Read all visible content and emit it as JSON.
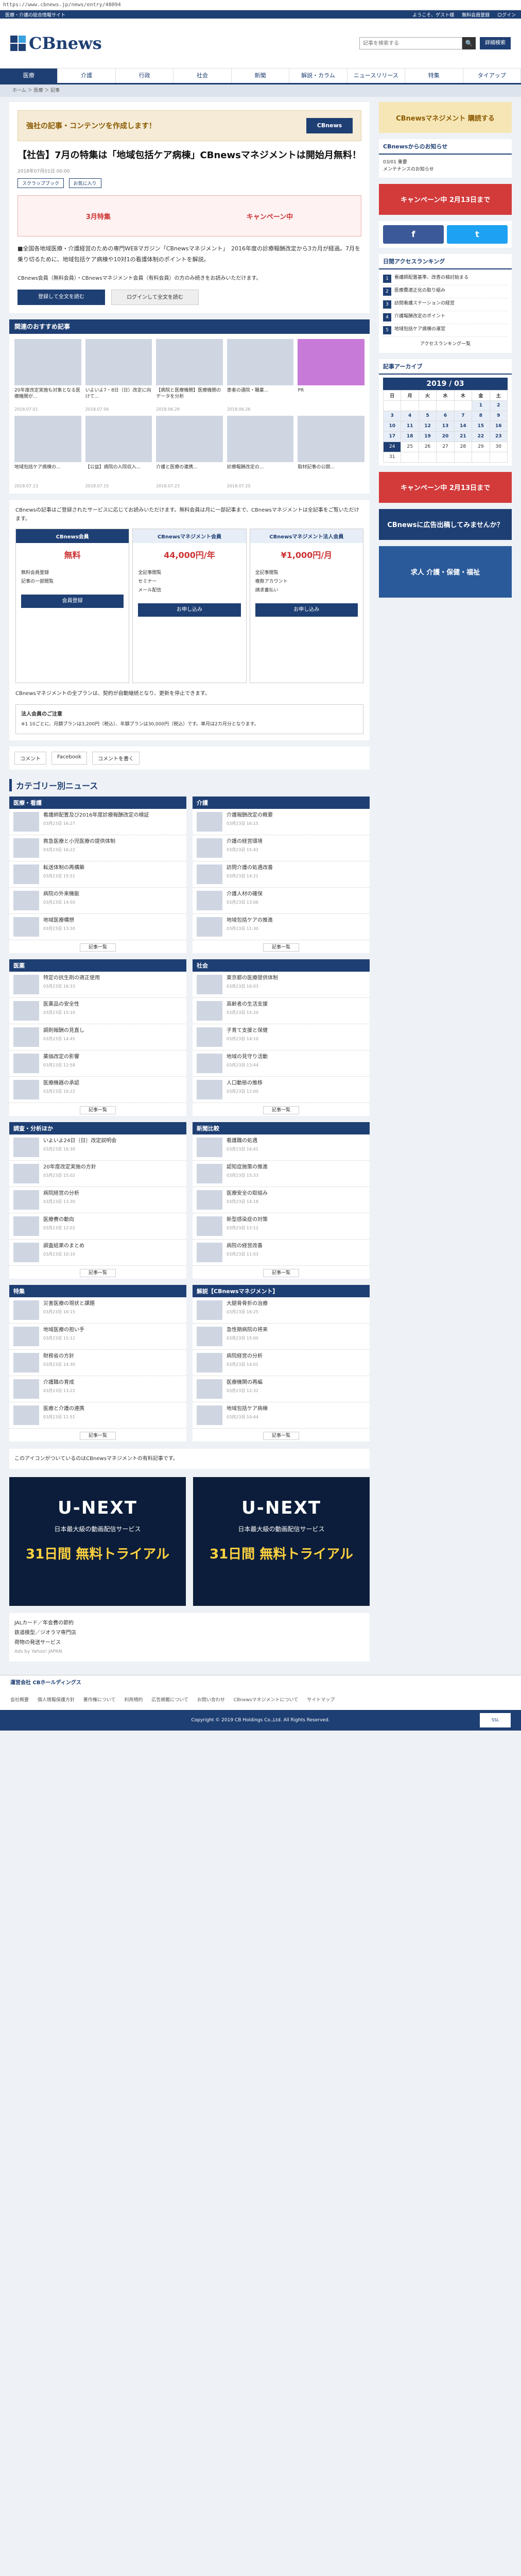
{
  "browser": {
    "url": "https://www.cbnews.jp/news/entry/48094"
  },
  "topbar": {
    "tagline": "医療・介護の総合情報サイト",
    "welcome": "ようこそ、ゲスト様",
    "register": "無料会員登録",
    "login": "ログイン"
  },
  "header": {
    "logo": "CBnews",
    "search_placeholder": "記事を検索する",
    "detail_search": "詳細検索"
  },
  "gnav": [
    "医療",
    "介護",
    "行政",
    "社会",
    "新聞",
    "解説・カラム",
    "ニュースリリース",
    "特集",
    "タイアップ"
  ],
  "breadcrumb": "ホーム ＞ 医療 ＞ 記事",
  "article": {
    "ad_banner": "強社の記事・コンテンツを作成します！",
    "ad_button": "CBnews",
    "title": "【社告】7月の特集は「地域包括ケア病棟」CBnewsマネジメントは開始月無料！",
    "date": "2018年07月01日 00:00",
    "tags": [
      "スクラップブック",
      "お気に入り"
    ],
    "wide_ad_left": "3月特集",
    "wide_ad_right": "キャンペーン中",
    "bullet": "■全国各地域医療・介護経営のための専門WEBマガジン「CBnewsマネジメント」　2016年度の診療報酬改定から3カ月が経過。7月を乗り切るために、地域包括ケア病棟や10対1の看護体制のポイントを解説。",
    "sub_note": "CBnews会員（無料会員）・CBnewsマネジメント会員（有料会員）の方のみ続きをお読みいただけます。",
    "btn_register": "登録して全文を読む",
    "btn_login": "ログインして全文を読む"
  },
  "recommend": {
    "heading": "関連のおすすめ記事",
    "items": [
      {
        "title": "20年度改定実施も対象となる医療機関が...",
        "date": "2018.07.01"
      },
      {
        "title": "いよいよ7・8日（日）改定に向けて...",
        "date": "2018.07.04"
      },
      {
        "title": "【病院と医療機関】医療機関のデータを分析",
        "date": "2018.06.29"
      },
      {
        "title": "患者の通院・職業...",
        "date": "2018.06.26"
      },
      {
        "title": "PR",
        "date": ""
      },
      {
        "title": "地域包括ケア病棟の...",
        "date": "2018.07.13"
      },
      {
        "title": "【公益】病院の入院収入...",
        "date": "2018.07.15"
      },
      {
        "title": "介護と医療の連携...",
        "date": "2018.07.23"
      },
      {
        "title": "診療報酬改定の...",
        "date": "2018.07.25"
      },
      {
        "title": "取材記事の公開...",
        "date": ""
      }
    ]
  },
  "pricing": {
    "lead": "CBnewsの記事はご登録されたサービスに応じてお読みいただけます。無料会員は月に一部記事まで、CBnewsマネジメントは全記事をご覧いただけます。",
    "cols": [
      {
        "name": "CBnews会員",
        "price": "無料",
        "items": [
          "無料会員登録",
          "記事の一部閲覧"
        ],
        "cta": "会員登録"
      },
      {
        "name": "CBnewsマネジメント会員",
        "price": "44,000円/年",
        "items": [
          "全記事閲覧",
          "セミナー",
          "メール配信"
        ],
        "cta": "お申し込み"
      },
      {
        "name": "CBnewsマネジメント法人会員",
        "price": "¥1,000円/月",
        "items": [
          "全記事閲覧",
          "複数アカウント",
          "請求書払い"
        ],
        "cta": "お申し込み"
      }
    ],
    "note": "CBnewsマネジメントの全プランは、契約が自動継続となり、更新を停止できます。",
    "legal_title": "法人会員のご注意",
    "legal_text": "※1 10ごとに、月額プランは3,200円（税込）、年額プランは30,000円（税込）です。単月は2カ月分となります。"
  },
  "comments": {
    "comment": "コメント",
    "facebook": "Facebook",
    "add": "コメントを書く"
  },
  "categories": {
    "heading": "カテゴリー別ニュース",
    "blocks": [
      {
        "name": "医療・看護",
        "items": [
          {
            "t": "看護師配置及び2016年度診療報酬改定の検証",
            "tm": "03月23日 16:27"
          },
          {
            "t": "救急医療と小児医療の提供体制",
            "tm": "03月23日 16:22"
          },
          {
            "t": "転送体制の再構築",
            "tm": "03月23日 15:51"
          },
          {
            "t": "病院の外来機能",
            "tm": "03月23日 14:50"
          },
          {
            "t": "地域医療構想",
            "tm": "03月23日 13:30"
          }
        ]
      },
      {
        "name": "介護",
        "items": [
          {
            "t": "介護報酬改定の概要",
            "tm": "03月23日 16:15"
          },
          {
            "t": "介護の経営環境",
            "tm": "03月23日 15:42"
          },
          {
            "t": "訪問介護の処遇改善",
            "tm": "03月23日 14:21"
          },
          {
            "t": "介護人材の確保",
            "tm": "03月23日 13:06"
          },
          {
            "t": "地域包括ケアの推進",
            "tm": "03月23日 11:30"
          }
        ]
      },
      {
        "name": "医薬",
        "items": [
          {
            "t": "特定の抗生剤の適正使用",
            "tm": "03月23日 16:33"
          },
          {
            "t": "医薬品の安全性",
            "tm": "03月23日 15:10"
          },
          {
            "t": "調剤報酬の見直し",
            "tm": "03月23日 14:45"
          },
          {
            "t": "薬価改定の影響",
            "tm": "03月23日 12:58"
          },
          {
            "t": "医療機器の承認",
            "tm": "03月23日 10:22"
          }
        ]
      },
      {
        "name": "社会",
        "items": [
          {
            "t": "東京都の医療提供体制",
            "tm": "03月23日 16:03"
          },
          {
            "t": "高齢者の生活支援",
            "tm": "03月23日 15:20"
          },
          {
            "t": "子育て支援と保健",
            "tm": "03月23日 14:10"
          },
          {
            "t": "地域の見守り活動",
            "tm": "03月23日 13:44"
          },
          {
            "t": "人口動態の推移",
            "tm": "03月23日 12:00"
          }
        ]
      },
      {
        "name": "調査・分析ほか",
        "items": [
          {
            "t": "いよいよ24日（日）改定説明会",
            "tm": "03月23日 16:30"
          },
          {
            "t": "20年度改定実施の方針",
            "tm": "03月23日 15:02"
          },
          {
            "t": "病院経営の分析",
            "tm": "03月23日 13:30"
          },
          {
            "t": "医療費の動向",
            "tm": "03月23日 12:02"
          },
          {
            "t": "調査結果のまとめ",
            "tm": "03月23日 10:10"
          }
        ]
      },
      {
        "name": "新聞比較",
        "items": [
          {
            "t": "看護職の処遇",
            "tm": "03月23日 16:41"
          },
          {
            "t": "認知症施策の推進",
            "tm": "03月23日 15:33"
          },
          {
            "t": "医療安全の取組み",
            "tm": "03月23日 14:18"
          },
          {
            "t": "新型感染症の対策",
            "tm": "03月23日 13:12"
          },
          {
            "t": "病院の経営改善",
            "tm": "03月23日 11:03"
          }
        ]
      },
      {
        "name": "特集",
        "items": [
          {
            "t": "災害医療の現状と課題",
            "tm": "03月23日 16:15"
          },
          {
            "t": "地域医療の担い手",
            "tm": "03月23日 15:12"
          },
          {
            "t": "財務省の方針",
            "tm": "03月23日 14:30"
          },
          {
            "t": "介護職の育成",
            "tm": "03月23日 13:22"
          },
          {
            "t": "医療と介護の連携",
            "tm": "03月23日 11:51"
          }
        ]
      },
      {
        "name": "解説【CBnewsマネジメント】",
        "items": [
          {
            "t": "大腿骨骨折の治療",
            "tm": "03月23日 16:25"
          },
          {
            "t": "急性期病院の将来",
            "tm": "03月23日 15:00"
          },
          {
            "t": "病院経営の分析",
            "tm": "03月23日 14:01"
          },
          {
            "t": "医療機関の再編",
            "tm": "03月23日 12:32"
          },
          {
            "t": "地域包括ケア病棟",
            "tm": "03月23日 10:44"
          }
        ]
      }
    ],
    "more": "記事一覧"
  },
  "ads_note": "このアイコンがついているのはCBnewsマネジメントの有料記事です。",
  "unext": {
    "logo": "U-NEXT",
    "copy": "日本最大級の動画配信サービス",
    "days": "31日間 無料トライアル"
  },
  "pr": {
    "label": "Ads by Yahoo! JAPAN",
    "links": [
      "JALカード／年会費の節約",
      "鉄道模型／ジオラマ専門店",
      "荷物の発送サービス"
    ]
  },
  "sidebar": {
    "banners": [
      "CBnewsマネジメント 購読する",
      "キャンペーン中 2月13日まで",
      "CBnewsに広告出稿してみませんか？",
      "求人 介護・保健・福祉"
    ],
    "notice_title": "CBnewsからのお知らせ",
    "notice_items": [
      "03/01 重要",
      "メンテナンスのお知らせ"
    ],
    "ranking_title": "日間アクセスランキング",
    "ranking": [
      "看護師配置基準、改善の検討始まる",
      "医療費適正化の取り組み",
      "訪問看護ステーションの経営",
      "介護報酬改定のポイント",
      "地域包括ケア病棟の運営"
    ],
    "ranking_more": "アクセスランキング一覧",
    "calendar_title": "記事アーカイブ",
    "calendar_month": "2019 / 03",
    "weekdays": [
      "日",
      "月",
      "火",
      "水",
      "木",
      "金",
      "土"
    ],
    "calendar_days": [
      "",
      "",
      "",
      "",
      "",
      "1",
      "2",
      "3",
      "4",
      "5",
      "6",
      "7",
      "8",
      "9",
      "10",
      "11",
      "12",
      "13",
      "14",
      "15",
      "16",
      "17",
      "18",
      "19",
      "20",
      "21",
      "22",
      "23",
      "24",
      "25",
      "26",
      "27",
      "28",
      "29",
      "30",
      "31",
      "",
      "",
      "",
      "",
      "",
      ""
    ]
  },
  "footer": {
    "bar": "運営会社 CBホールディングス",
    "links": [
      "会社概要",
      "個人情報保護方針",
      "著作権について",
      "利用規約",
      "広告掲載について",
      "お問い合わせ",
      "CBnewsマネジメントについて",
      "サイトマップ"
    ],
    "copyright": "Copyright © 2019 CB Holdings Co.,Ltd. All Rights Reserved."
  }
}
